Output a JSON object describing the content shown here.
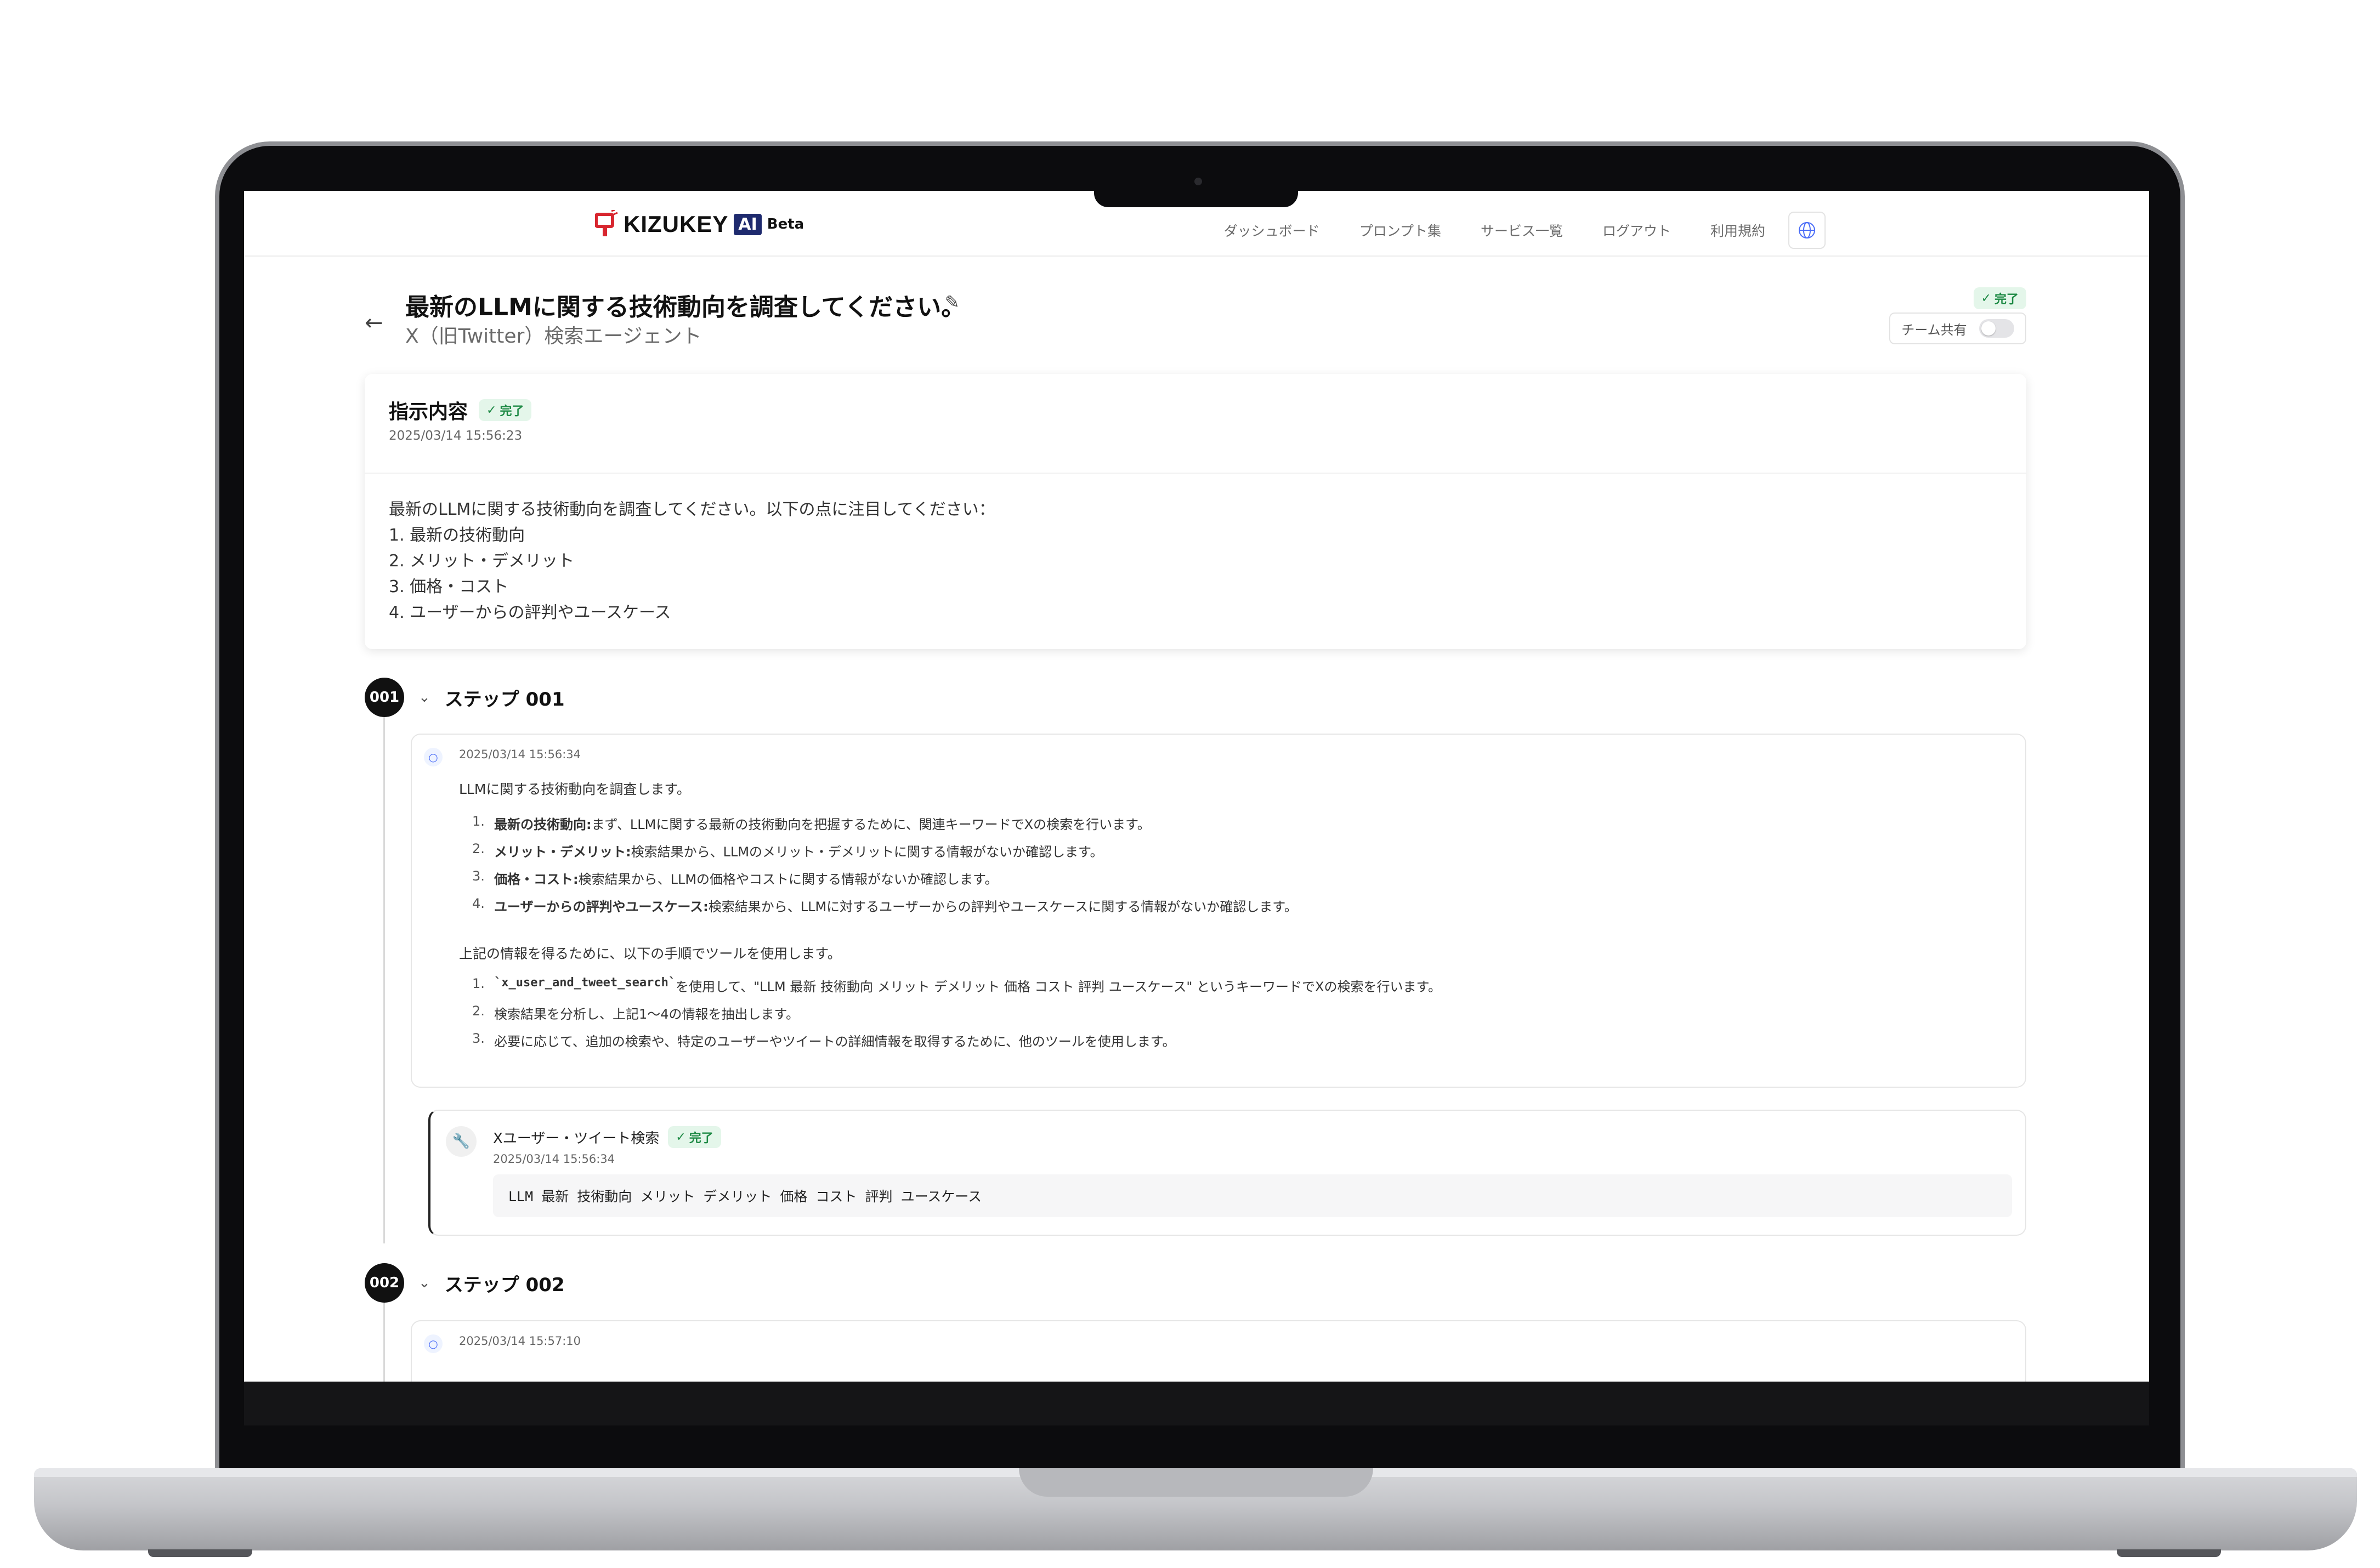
{
  "header": {
    "logo_text": "KIZUKEY",
    "logo_ai": "AI",
    "logo_beta": "Beta",
    "nav": [
      "ダッシュボード",
      "プロンプト集",
      "サービス一覧",
      "ログアウト",
      "利用規約"
    ]
  },
  "page": {
    "title": "最新のLLMに関する技術動向を調査してください。",
    "subtitle": "X（旧Twitter）検索エージェント",
    "status": "完了",
    "share_label": "チーム共有",
    "share_enabled": false
  },
  "instruction": {
    "title": "指示内容",
    "status": "完了",
    "time": "2025/03/14 15:56:23",
    "lines": [
      "最新のLLMに関する技術動向を調査してください。以下の点に注目してください：",
      "1. 最新の技術動向",
      "2. メリット・デメリット",
      "3. 価格・コスト",
      "4. ユーザーからの評判やユースケース"
    ]
  },
  "steps": [
    {
      "num": "001",
      "label": "ステップ 001",
      "message": {
        "time": "2025/03/14 15:56:34",
        "intro": "LLMに関する技術動向を調査します。",
        "items": [
          {
            "n": "1.",
            "bold": "最新の技術動向:",
            "text": " まず、LLMに関する最新の技術動向を把握するために、関連キーワードでXの検索を行います。"
          },
          {
            "n": "2.",
            "bold": "メリット・デメリット:",
            "text": " 検索結果から、LLMのメリット・デメリットに関する情報がないか確認します。"
          },
          {
            "n": "3.",
            "bold": "価格・コスト:",
            "text": " 検索結果から、LLMの価格やコストに関する情報がないか確認します。"
          },
          {
            "n": "4.",
            "bold": "ユーザーからの評判やユースケース:",
            "text": " 検索結果から、LLMに対するユーザーからの評判やユースケースに関する情報がないか確認します。"
          }
        ],
        "mid": "上記の情報を得るために、以下の手順でツールを使用します。",
        "items2": [
          {
            "n": "1.",
            "code": "`x_user_and_tweet_search`",
            "text": " を使用して、\"LLM 最新 技術動向 メリット デメリット 価格 コスト 評判 ユースケース\" というキーワードでXの検索を行います。"
          },
          {
            "n": "2.",
            "text": "検索結果を分析し、上記1〜4の情報を抽出します。"
          },
          {
            "n": "3.",
            "text": "必要に応じて、追加の検索や、特定のユーザーやツイートの詳細情報を取得するために、他のツールを使用します。"
          }
        ]
      },
      "tool": {
        "name": "Xユーザー・ツイート検索",
        "status": "完了",
        "time": "2025/03/14 15:56:34",
        "query": "LLM 最新 技術動向 メリット デメリット 価格 コスト 評判 ユースケース"
      }
    },
    {
      "num": "002",
      "label": "ステップ 002",
      "message": {
        "time": "2025/03/14 15:57:10"
      }
    }
  ]
}
